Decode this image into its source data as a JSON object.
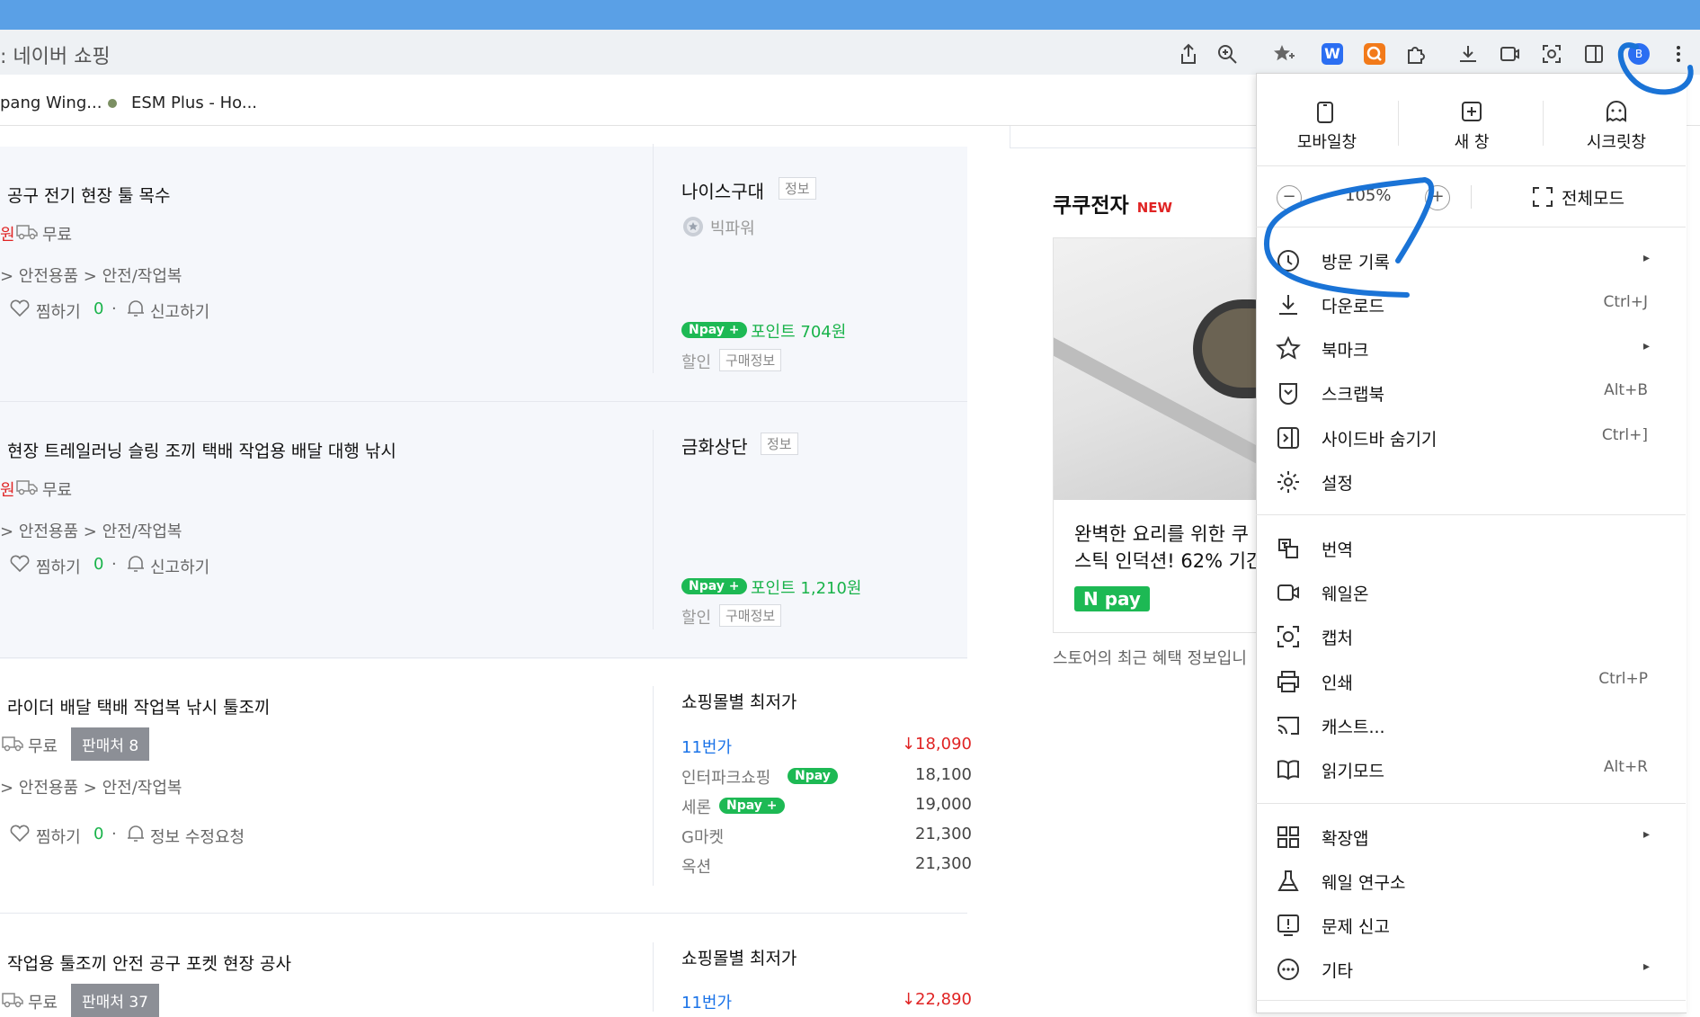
{
  "browser": {
    "address_text": ": 네이버 쇼핑",
    "bookmarks": [
      "pang Wing...",
      "ESM Plus - Ho..."
    ],
    "profile_initial": "B"
  },
  "products": [
    {
      "title": "공구 전기 현장 툴 목수",
      "shipping": "무료",
      "category": "> 안전용품 > 안전/작업복",
      "wish_label": "찜하기",
      "wish_count": "0",
      "report_label": "신고하기",
      "seller": "나이스구대",
      "seller_tag": "정보",
      "seller_grade": "빅파워",
      "npay_point": "포인트 704원",
      "discount_label": "할인",
      "purchase_info": "구매정보"
    },
    {
      "title": "현장 트레일러닝 슬링 조끼 택배 작업용 배달 대행 낚시",
      "shipping": "무료",
      "category": "> 안전용품 > 안전/작업복",
      "wish_label": "찜하기",
      "wish_count": "0",
      "report_label": "신고하기",
      "seller": "금화상단",
      "seller_tag": "정보",
      "npay_point": "포인트 1,210원",
      "discount_label": "할인",
      "purchase_info": "구매정보"
    },
    {
      "title": "라이더 배달 택배 작업복 낚시 툴조끼",
      "shipping": "무료",
      "sellers_badge": "판매처 8",
      "category": "> 안전용품 > 안전/작업복",
      "wish_label": "찜하기",
      "wish_count": "0",
      "report_label": "정보 수정요청",
      "mall_header": "쇼핑몰별 최저가",
      "malls": [
        {
          "name": "11번가",
          "price": "18,090"
        },
        {
          "name": "인터파크쇼핑",
          "price": "18,100"
        },
        {
          "name": "세론",
          "price": "19,000"
        },
        {
          "name": "G마켓",
          "price": "21,300"
        },
        {
          "name": "옥션",
          "price": "21,300"
        }
      ]
    },
    {
      "title": "작업용 툴조끼 안전 공구 포켓 현장 공사",
      "shipping": "무료",
      "sellers_badge": "판매처 37",
      "mall_header": "쇼핑몰별 최저가",
      "malls": [
        {
          "name": "11번가",
          "price": "22,890"
        }
      ]
    }
  ],
  "npay_text": "pay",
  "promo": {
    "store_name": "쿠쿠전자",
    "new_badge": "NEW",
    "card_text_1": "완벽한 요리를 위한 쿠",
    "card_text_2": "스틱 인덕션! 62% 기간",
    "npay_label": "pay",
    "footer": "스토어의 최근 혜택 정보입니"
  },
  "menu": {
    "top": [
      {
        "label": "모바일창"
      },
      {
        "label": "새 창"
      },
      {
        "label": "시크릿창"
      }
    ],
    "zoom_minus": "−",
    "zoom_value": "105%",
    "zoom_plus": "+",
    "fullscreen_label": "전체모드",
    "items": [
      {
        "label": "방문 기록",
        "shortcut": "",
        "arrow": true
      },
      {
        "label": "다운로드",
        "shortcut": "Ctrl+J",
        "arrow": false
      },
      {
        "label": "북마크",
        "shortcut": "",
        "arrow": true
      },
      {
        "label": "스크랩북",
        "shortcut": "Alt+B",
        "arrow": false
      },
      {
        "label": "사이드바 숨기기",
        "shortcut": "Ctrl+]",
        "arrow": false
      },
      {
        "label": "설정",
        "shortcut": "",
        "arrow": false
      },
      {
        "label": "번역",
        "shortcut": "",
        "arrow": false
      },
      {
        "label": "웨일온",
        "shortcut": "",
        "arrow": false
      },
      {
        "label": "캡처",
        "shortcut": "",
        "arrow": false
      },
      {
        "label": "인쇄",
        "shortcut": "Ctrl+P",
        "arrow": false
      },
      {
        "label": "캐스트...",
        "shortcut": "",
        "arrow": false
      },
      {
        "label": "읽기모드",
        "shortcut": "Alt+R",
        "arrow": false
      },
      {
        "label": "확장앱",
        "shortcut": "",
        "arrow": true
      },
      {
        "label": "웨일 연구소",
        "shortcut": "",
        "arrow": false
      },
      {
        "label": "문제 신고",
        "shortcut": "",
        "arrow": false
      },
      {
        "label": "기타",
        "shortcut": "",
        "arrow": true
      }
    ]
  },
  "colors": {
    "titlebar": "#5aa0e6",
    "annotation_blue": "#1a73d6",
    "npay_green": "#1db954",
    "price_red": "#e02424"
  }
}
